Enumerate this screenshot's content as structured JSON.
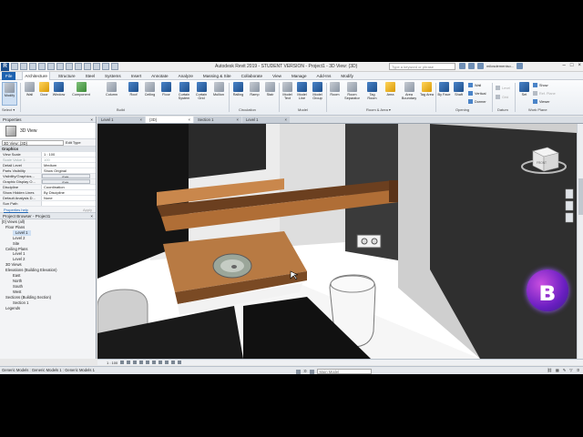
{
  "app": {
    "title": "Autodesk Revit 2019 - STUDENT VERSION - Project1 - 3D View: {3D}",
    "search_placeholder": "Type a keyword or phrase",
    "username": "milosdemeniso..."
  },
  "ribbon": {
    "tabs": [
      "File",
      "Architecture",
      "Structure",
      "Steel",
      "Systems",
      "Insert",
      "Annotate",
      "Analyze",
      "Massing & Site",
      "Collaborate",
      "View",
      "Manage",
      "Add-Ins",
      "Modify"
    ],
    "active_tab": "Architecture",
    "modify_label": "Modify",
    "select_label": "Select ▾",
    "build_buttons": [
      "Wall",
      "Door",
      "Window",
      "Component",
      "Column",
      "Roof",
      "Ceiling",
      "Floor",
      "Curtain System",
      "Curtain Grid",
      "Mullion"
    ],
    "circulation_buttons": [
      "Railing",
      "Ramp",
      "Stair"
    ],
    "model_buttons": [
      "Model Text",
      "Model Line",
      "Model Group"
    ],
    "room_buttons": [
      "Room",
      "Room Separator",
      "Tag Room",
      "Area",
      "Area Boundary",
      "Tag Area"
    ],
    "opening_buttons": [
      "By Face",
      "Shaft"
    ],
    "opening_small": [
      "Wall",
      "Vertical",
      "Dormer"
    ],
    "datum_small": [
      "Level",
      "Grid"
    ],
    "workplane_buttons": [
      "Set"
    ],
    "workplane_small": [
      "Show",
      "Ref. Plane",
      "Viewer"
    ],
    "groups": [
      "Build",
      "Circulation",
      "Model",
      "Room & Area ▾",
      "Opening",
      "Datum",
      "Work Plane"
    ]
  },
  "properties": {
    "header": "Properties",
    "type_name": "3D View",
    "view_selector": "3D View: {3D}",
    "edit_type": "Edit Type",
    "category": "Graphics",
    "rows": [
      {
        "k": "View Scale",
        "v": "1 : 100"
      },
      {
        "k": "Scale Value 1:",
        "v": "100"
      },
      {
        "k": "Detail Level",
        "v": "Medium"
      },
      {
        "k": "Parts Visibility",
        "v": "Show Original"
      },
      {
        "k": "Visibility/Graphics...",
        "v": "Edit..."
      },
      {
        "k": "Graphic Display O...",
        "v": "Edit..."
      },
      {
        "k": "Discipline",
        "v": "Coordination"
      },
      {
        "k": "Show Hidden Lines",
        "v": "By Discipline"
      },
      {
        "k": "Default Analysis D...",
        "v": "None"
      },
      {
        "k": "Sun Path",
        "v": ""
      }
    ],
    "help_link": "Properties help",
    "apply": "Apply"
  },
  "browser": {
    "header": "Project Browser - Project1",
    "items": [
      "[0] Views (all)",
      "Floor Plans",
      "Level 1",
      "Level 2",
      "Site",
      "Ceiling Plans",
      "Level 1",
      "Level 2",
      "3D Views",
      "Elevations (Building Elevation)",
      "East",
      "North",
      "South",
      "West",
      "Sections (Building Section)",
      "Section 1",
      "Legends"
    ]
  },
  "view_tabs": [
    {
      "label": "Level 1"
    },
    {
      "label": "{3D}"
    },
    {
      "label": "Section 1"
    },
    {
      "label": "Level 1"
    }
  ],
  "view_control": {
    "scale": "1 : 100"
  },
  "status": {
    "text": "Generic Models : Generic Models 1 : Generic Models 1",
    "zero": ":0",
    "model": "Main Model"
  },
  "viewcube": {
    "face": "FRONT"
  }
}
